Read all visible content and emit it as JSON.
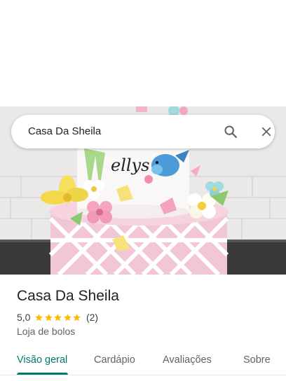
{
  "search": {
    "query": "Casa Da Sheila"
  },
  "hero": {
    "cake_lettering": "ellys"
  },
  "place": {
    "name": "Casa Da Sheila",
    "rating": "5,0",
    "stars": 5,
    "review_count": "(2)",
    "category": "Loja de bolos"
  },
  "tabs": [
    {
      "label": "Visão geral",
      "active": true
    },
    {
      "label": "Cardápio",
      "active": false
    },
    {
      "label": "Avaliações",
      "active": false
    },
    {
      "label": "Sobre",
      "active": false
    }
  ],
  "colors": {
    "accent": "#00796b",
    "star": "#fbbc04",
    "text_primary": "#202124",
    "text_secondary": "#5f6368"
  },
  "icons": {
    "search": "search-icon",
    "close": "close-icon",
    "star": "star-icon"
  }
}
